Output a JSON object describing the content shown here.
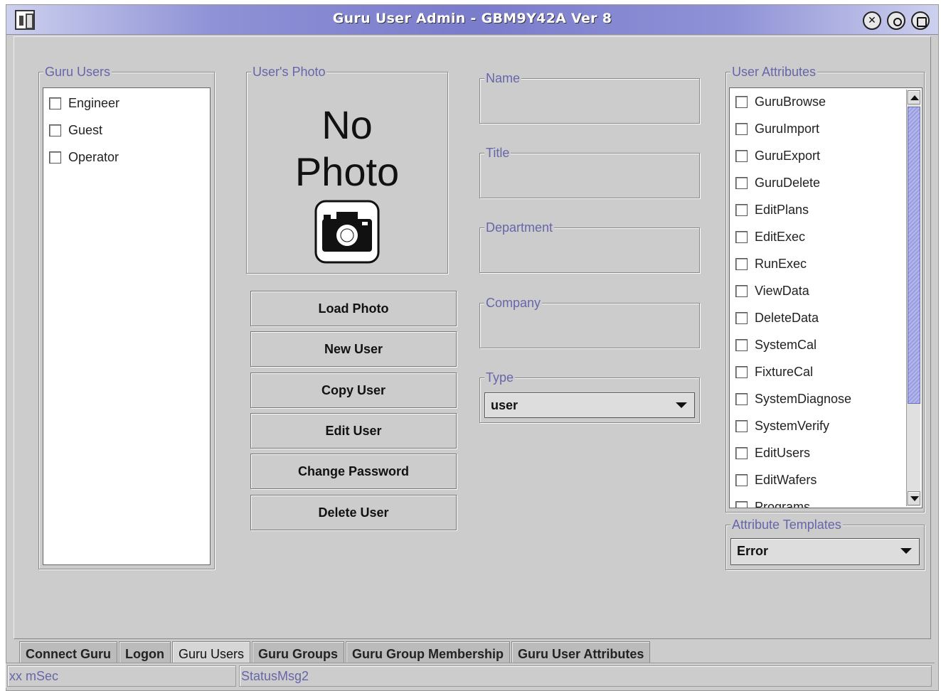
{
  "window": {
    "title": "Guru User Admin - GBM9Y42A Ver 8",
    "close_glyph": "✕"
  },
  "guru_users": {
    "legend": "Guru Users",
    "items": [
      "Engineer",
      "Guest",
      "Operator"
    ]
  },
  "photo": {
    "legend": "User's Photo",
    "line1": "No",
    "line2": "Photo",
    "icon": "camera-icon"
  },
  "buttons": {
    "load_photo": "Load Photo",
    "new_user": "New User",
    "copy_user": "Copy User",
    "edit_user": "Edit User",
    "change_password": "Change Password",
    "delete_user": "Delete User"
  },
  "fields": {
    "name": {
      "legend": "Name",
      "value": ""
    },
    "title": {
      "legend": "Title",
      "value": ""
    },
    "department": {
      "legend": "Department",
      "value": ""
    },
    "company": {
      "legend": "Company",
      "value": ""
    },
    "type": {
      "legend": "Type",
      "value": "user"
    }
  },
  "user_attributes": {
    "legend": "User Attributes",
    "items": [
      "GuruBrowse",
      "GuruImport",
      "GuruExport",
      "GuruDelete",
      "EditPlans",
      "EditExec",
      "RunExec",
      "ViewData",
      "DeleteData",
      "SystemCal",
      "FixtureCal",
      "SystemDiagnose",
      "SystemVerify",
      "EditUsers",
      "EditWafers",
      "Programs"
    ]
  },
  "attribute_templates": {
    "legend": "Attribute Templates",
    "value": "Error"
  },
  "tabs": {
    "items": [
      "Connect Guru",
      "Logon",
      "Guru Users",
      "Guru Groups",
      "Guru Group Membership",
      "Guru User Attributes"
    ],
    "active": "Guru Users"
  },
  "status": {
    "timing": "xx mSec",
    "message": "StatusMsg2"
  },
  "colors": {
    "title_gradient": "#7a7ccc",
    "legend_text": "#6666aa",
    "panel_bg": "#cccccc",
    "scroll_thumb": "#9a9ee0"
  }
}
